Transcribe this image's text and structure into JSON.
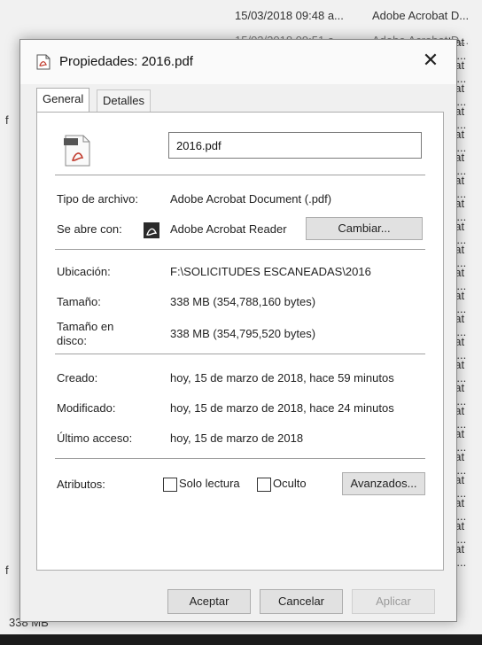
{
  "background": {
    "rows": [
      {
        "date": "15/03/2018 09:48 a...",
        "type": "Adobe Acrobat D..."
      },
      {
        "date": "15/03/2018 09:51 a...",
        "type": "Adobe Acrobat D..."
      }
    ],
    "type_short": "bat D...",
    "left_mark": "f",
    "size_text": "338 MB"
  },
  "dialog": {
    "title": "Propiedades: 2016.pdf",
    "close_glyph": "✕",
    "tabs": [
      "General",
      "Detalles"
    ],
    "filename": "2016.pdf",
    "file_type_label": "Tipo de archivo:",
    "file_type_value": "Adobe Acrobat Document (.pdf)",
    "opens_with_label": "Se abre con:",
    "opens_with_value": "Adobe Acrobat Reader",
    "change_button": "Cambiar...",
    "location_label": "Ubicación:",
    "location_value": "F:\\SOLICITUDES ESCANEADAS\\2016",
    "size_label": "Tamaño:",
    "size_value": "338 MB (354,788,160 bytes)",
    "size_on_disk_label_1": "Tamaño en",
    "size_on_disk_label_2": "disco:",
    "size_on_disk_value": "338 MB (354,795,520 bytes)",
    "created_label": "Creado:",
    "created_value": "hoy, 15 de marzo de 2018, hace 59 minutos",
    "modified_label": "Modificado:",
    "modified_value": "hoy, 15 de marzo de 2018, hace 24 minutos",
    "accessed_label": "Último acceso:",
    "accessed_value": "hoy, 15 de marzo de 2018",
    "attributes_label": "Atributos:",
    "readonly_label": "Solo lectura",
    "hidden_label": "Oculto",
    "advanced_button": "Avanzados...",
    "ok_button": "Aceptar",
    "cancel_button": "Cancelar",
    "apply_button": "Aplicar",
    "readonly_checked": false,
    "hidden_checked": false
  },
  "colors": {
    "pdf_red": "#c0392b",
    "disabled_text": "#9a9a9a"
  }
}
